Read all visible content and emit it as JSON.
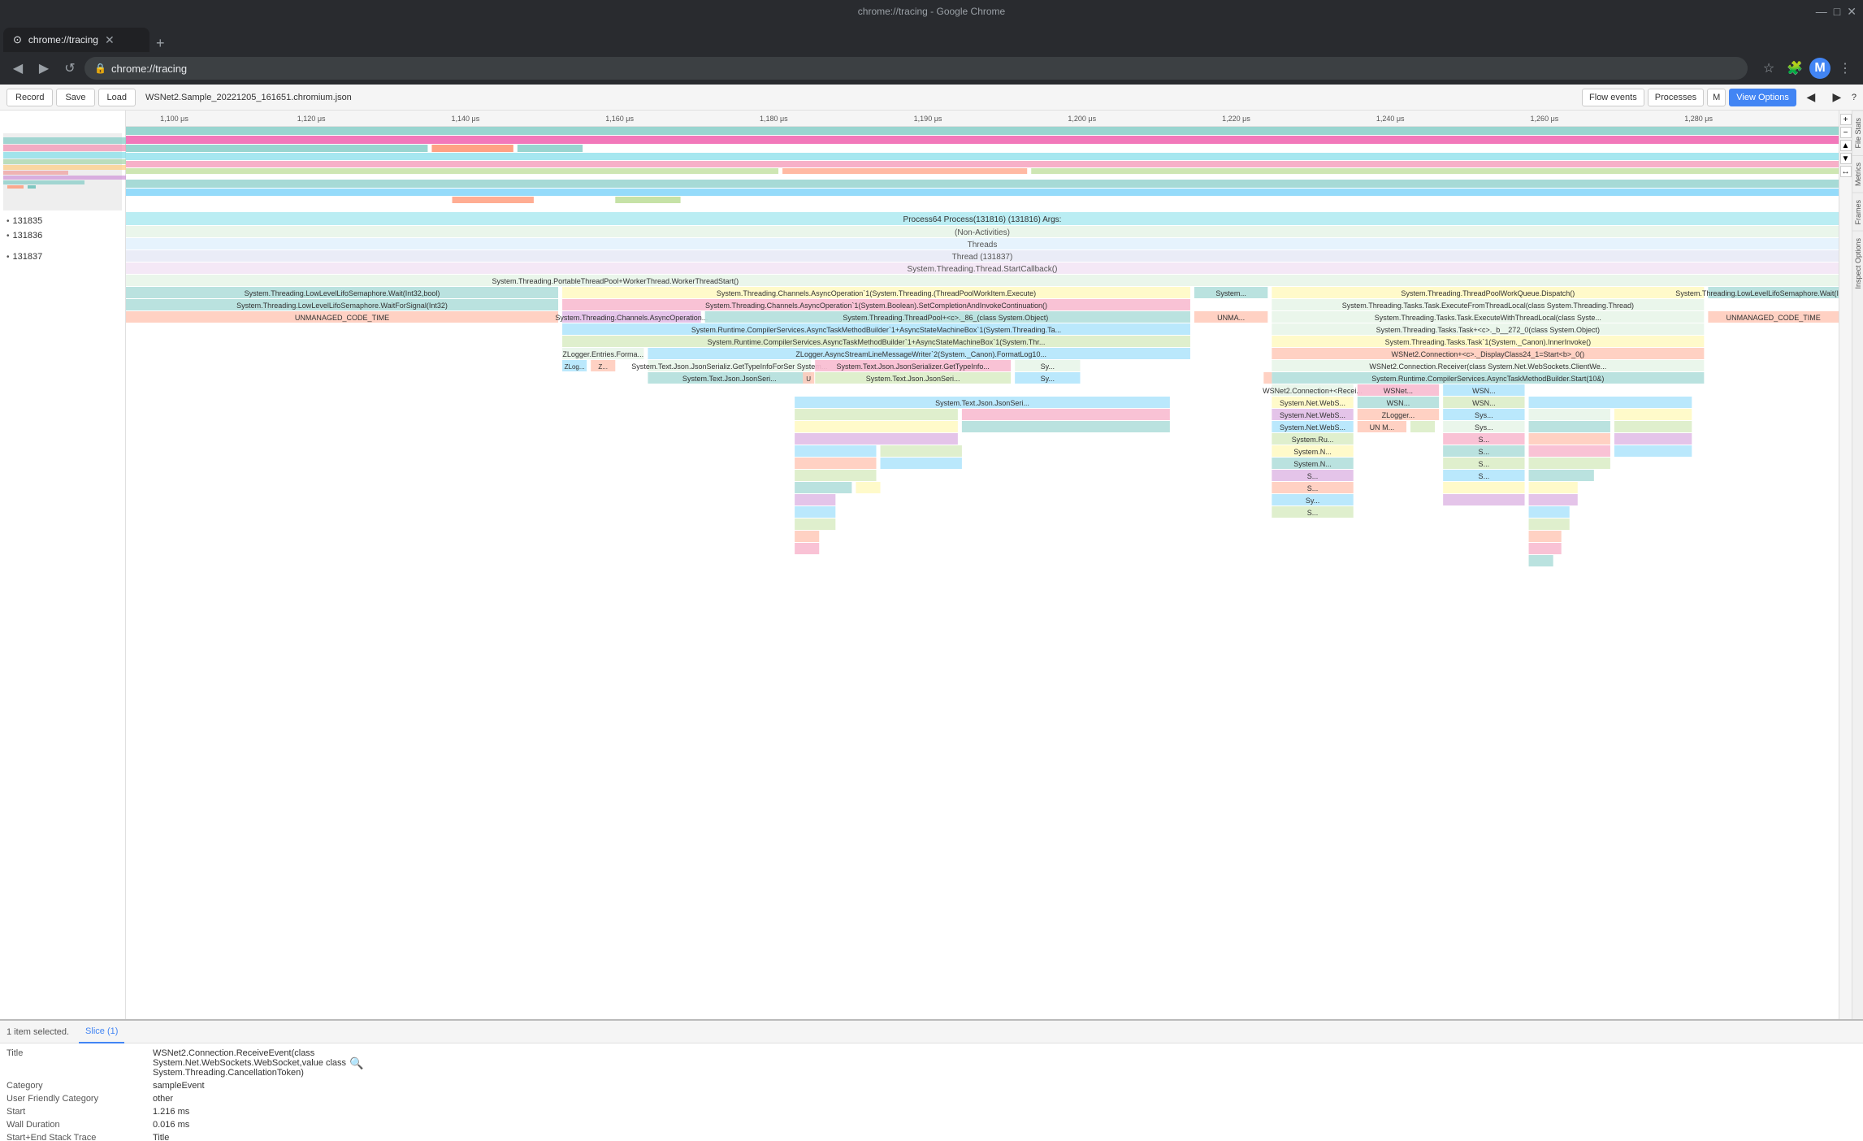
{
  "browser": {
    "title": "chrome://tracing - Google Chrome",
    "tab_label": "chrome://tracing",
    "address": "chrome://tracing",
    "address_icon": "🔒"
  },
  "toolbar": {
    "record_label": "Record",
    "save_label": "Save",
    "load_label": "Load",
    "filename": "WSNet2.Sample_20221205_161651.chromium.json",
    "flow_events_label": "Flow events",
    "processes_label": "Processes",
    "m_label": "M",
    "view_options_label": "View Options"
  },
  "sidebar": {
    "items": [
      {
        "id": "131835",
        "label": "131835"
      },
      {
        "id": "131836",
        "label": "131836"
      },
      {
        "id": "131837",
        "label": "131837"
      }
    ]
  },
  "ruler": {
    "marks": [
      {
        "pos": 0,
        "label": "1,100 μs"
      },
      {
        "pos": 12,
        "label": "1,120 μs"
      },
      {
        "pos": 25,
        "label": "1,140 μs"
      },
      {
        "pos": 37,
        "label": "1,160 μs"
      },
      {
        "pos": 50,
        "label": "1,180 μs"
      },
      {
        "pos": 62,
        "label": "1,190 μs"
      },
      {
        "pos": 75,
        "label": "1,200 μs"
      },
      {
        "pos": 87,
        "label": "1,220 μs"
      },
      {
        "pos": 100,
        "label": "1,240 μs"
      },
      {
        "pos": 112,
        "label": "1,260 μs"
      },
      {
        "pos": 125,
        "label": "1,280 μs"
      }
    ]
  },
  "process": {
    "label": "Process64 Process(131816) (131816) Args:",
    "non_activities": "(Non-Activities)",
    "threads": "Threads",
    "thread_label": "Thread (131837)",
    "thread_start_callback": "System.Threading.Thread.StartCallback()"
  },
  "bottom": {
    "status": "1 item selected.",
    "tab_label": "Slice (1)",
    "title_label": "Title",
    "title_value_line1": "WSNet2.Connection.ReceiveEvent(class",
    "title_value_line2": "System.Net.WebSockets.WebSocket,value class",
    "title_value_line3": "System.Threading.CancellationToken)",
    "category_label": "Category",
    "category_value": "sampleEvent",
    "user_friendly_label": "User Friendly Category",
    "user_friendly_value": "other",
    "start_label": "Start",
    "start_value": "1.216 ms",
    "wall_duration_label": "Wall Duration",
    "wall_duration_value": "0.016 ms",
    "stack_trace_label": "Start+End Stack Trace",
    "stack_trace_value": "Title"
  },
  "right_sidebar": {
    "tabs": [
      "File Stats",
      "Metrics",
      "Frames",
      "Inspect Options"
    ]
  },
  "zoom": {
    "scroll_left": "◀",
    "scroll_right": "▶",
    "zoom_in": "+",
    "zoom_out": "-"
  }
}
